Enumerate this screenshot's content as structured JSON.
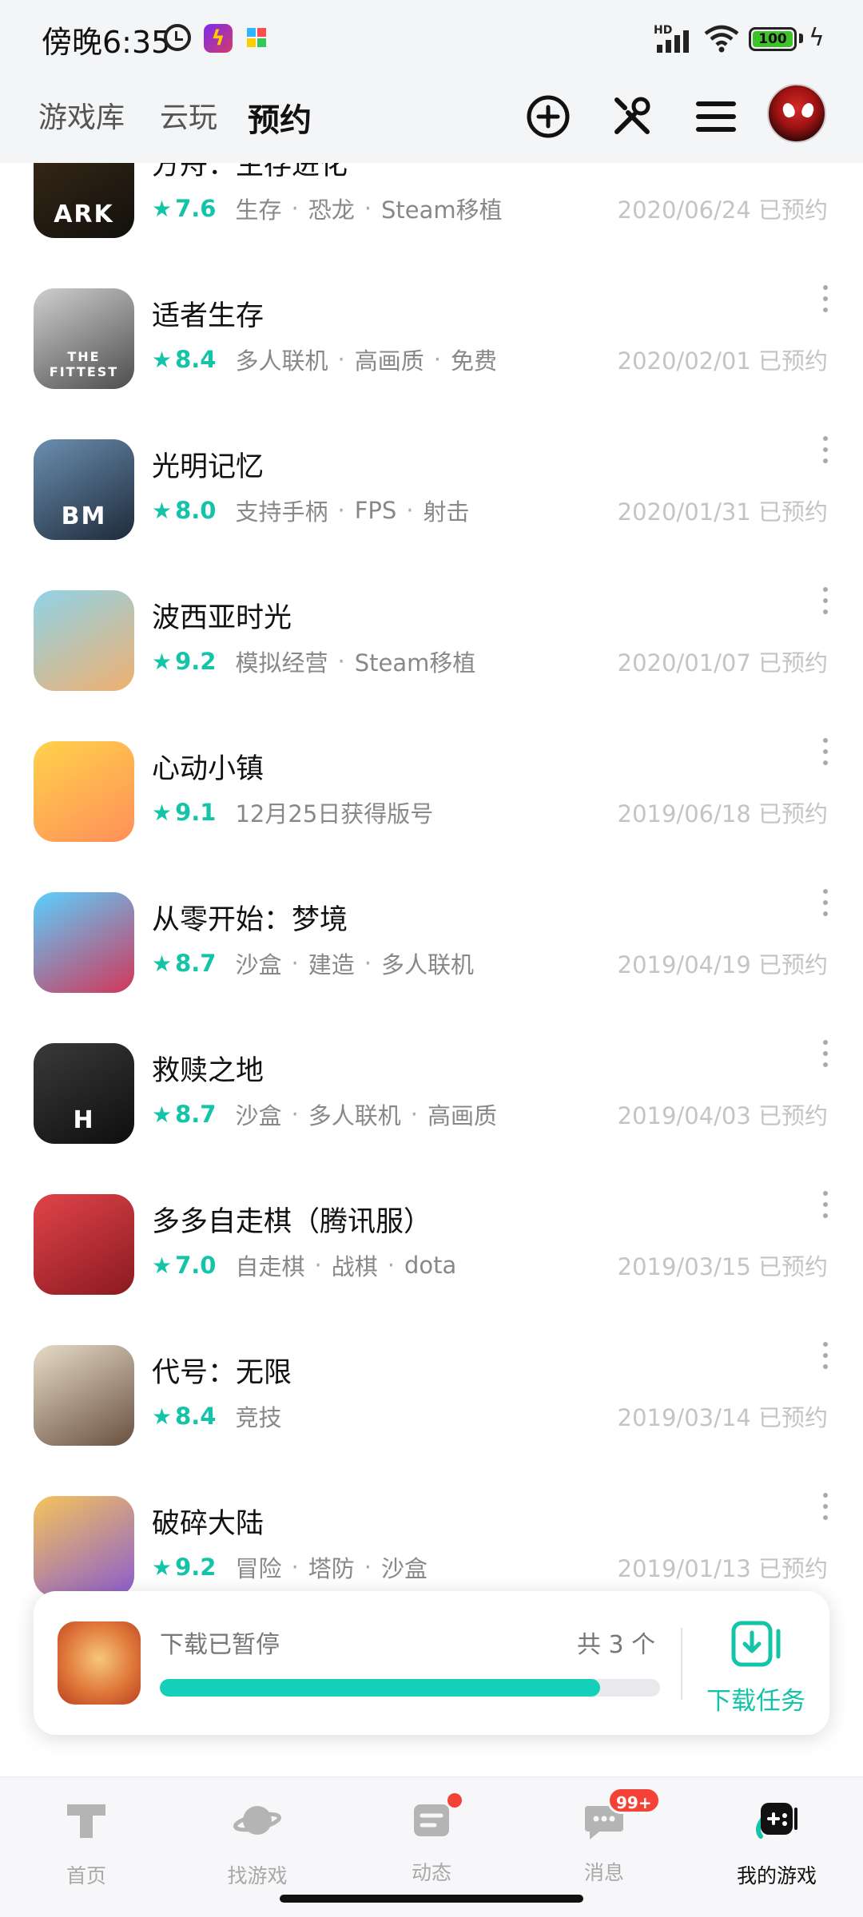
{
  "status_bar": {
    "time": "傍晚6:35",
    "network_label": "HD",
    "battery": "100"
  },
  "header": {
    "tabs": [
      {
        "label": "游戏库",
        "active": false
      },
      {
        "label": "云玩",
        "active": false
      },
      {
        "label": "预约",
        "active": true
      }
    ],
    "icons": [
      "add-circle-icon",
      "tools-icon",
      "menu-icon",
      "avatar"
    ]
  },
  "games": [
    {
      "title": "方舟：生存进化",
      "score": "7.6",
      "tags": [
        "生存",
        "恐龙",
        "Steam移植"
      ],
      "date": "2020/06/24 已预约",
      "icon_colors": [
        "#3a2a18",
        "#12100c"
      ],
      "icon_text": "ARK"
    },
    {
      "title": "适者生存",
      "score": "8.4",
      "tags": [
        "多人联机",
        "高画质",
        "免费"
      ],
      "date": "2020/02/01 已预约",
      "icon_colors": [
        "#cfcfcf",
        "#4d4d4d"
      ],
      "icon_text": "THE FITTEST"
    },
    {
      "title": "光明记忆",
      "score": "8.0",
      "tags": [
        "支持手柄",
        "FPS",
        "射击"
      ],
      "date": "2020/01/31 已预约",
      "icon_colors": [
        "#6b8fb0",
        "#1e2a3a"
      ],
      "icon_text": "BM"
    },
    {
      "title": "波西亚时光",
      "score": "9.2",
      "tags": [
        "模拟经营",
        "Steam移植"
      ],
      "date": "2020/01/07 已预约",
      "icon_colors": [
        "#8fd3e8",
        "#f0b070"
      ],
      "icon_text": ""
    },
    {
      "title": "心动小镇",
      "score": "9.1",
      "tags": [
        "12月25日获得版号"
      ],
      "date": "2019/06/18 已预约",
      "icon_colors": [
        "#ffd24a",
        "#ff8f5a"
      ],
      "icon_text": ""
    },
    {
      "title": "从零开始：梦境",
      "score": "8.7",
      "tags": [
        "沙盒",
        "建造",
        "多人联机"
      ],
      "date": "2019/04/19 已预约",
      "icon_colors": [
        "#5ad0ff",
        "#d2365a"
      ],
      "icon_text": ""
    },
    {
      "title": "救赎之地",
      "score": "8.7",
      "tags": [
        "沙盒",
        "多人联机",
        "高画质"
      ],
      "date": "2019/04/03 已预约",
      "icon_colors": [
        "#3a3a3a",
        "#0e0e0e"
      ],
      "icon_text": "H"
    },
    {
      "title": "多多自走棋（腾讯服）",
      "score": "7.0",
      "tags": [
        "自走棋",
        "战棋",
        "dota"
      ],
      "date": "2019/03/15 已预约",
      "icon_colors": [
        "#e0444a",
        "#8a1a20"
      ],
      "icon_text": ""
    },
    {
      "title": "代号：无限",
      "score": "8.4",
      "tags": [
        "竞技"
      ],
      "date": "2019/03/14 已预约",
      "icon_colors": [
        "#e6dcc8",
        "#6a5040"
      ],
      "icon_text": ""
    },
    {
      "title": "破碎大陆",
      "score": "9.2",
      "tags": [
        "冒险",
        "塔防",
        "沙盒"
      ],
      "date": "2019/01/13 已预约",
      "icon_colors": [
        "#f6c45a",
        "#8a5cd0"
      ],
      "icon_text": ""
    }
  ],
  "download": {
    "status": "下载已暂停",
    "count": "共 3 个",
    "progress_percent": 88,
    "task_label": "下载任务"
  },
  "bottom_nav": [
    {
      "label": "首页",
      "active": false,
      "icon": "home-icon"
    },
    {
      "label": "找游戏",
      "active": false,
      "icon": "planet-icon"
    },
    {
      "label": "动态",
      "active": false,
      "icon": "feed-icon",
      "dot": true
    },
    {
      "label": "消息",
      "active": false,
      "icon": "message-icon",
      "badge": "99+"
    },
    {
      "label": "我的游戏",
      "active": true,
      "icon": "gamepad-icon"
    }
  ],
  "colors": {
    "accent": "#14c4a8",
    "header_bg": "#f4f5f7",
    "badge_red": "#f44336"
  }
}
